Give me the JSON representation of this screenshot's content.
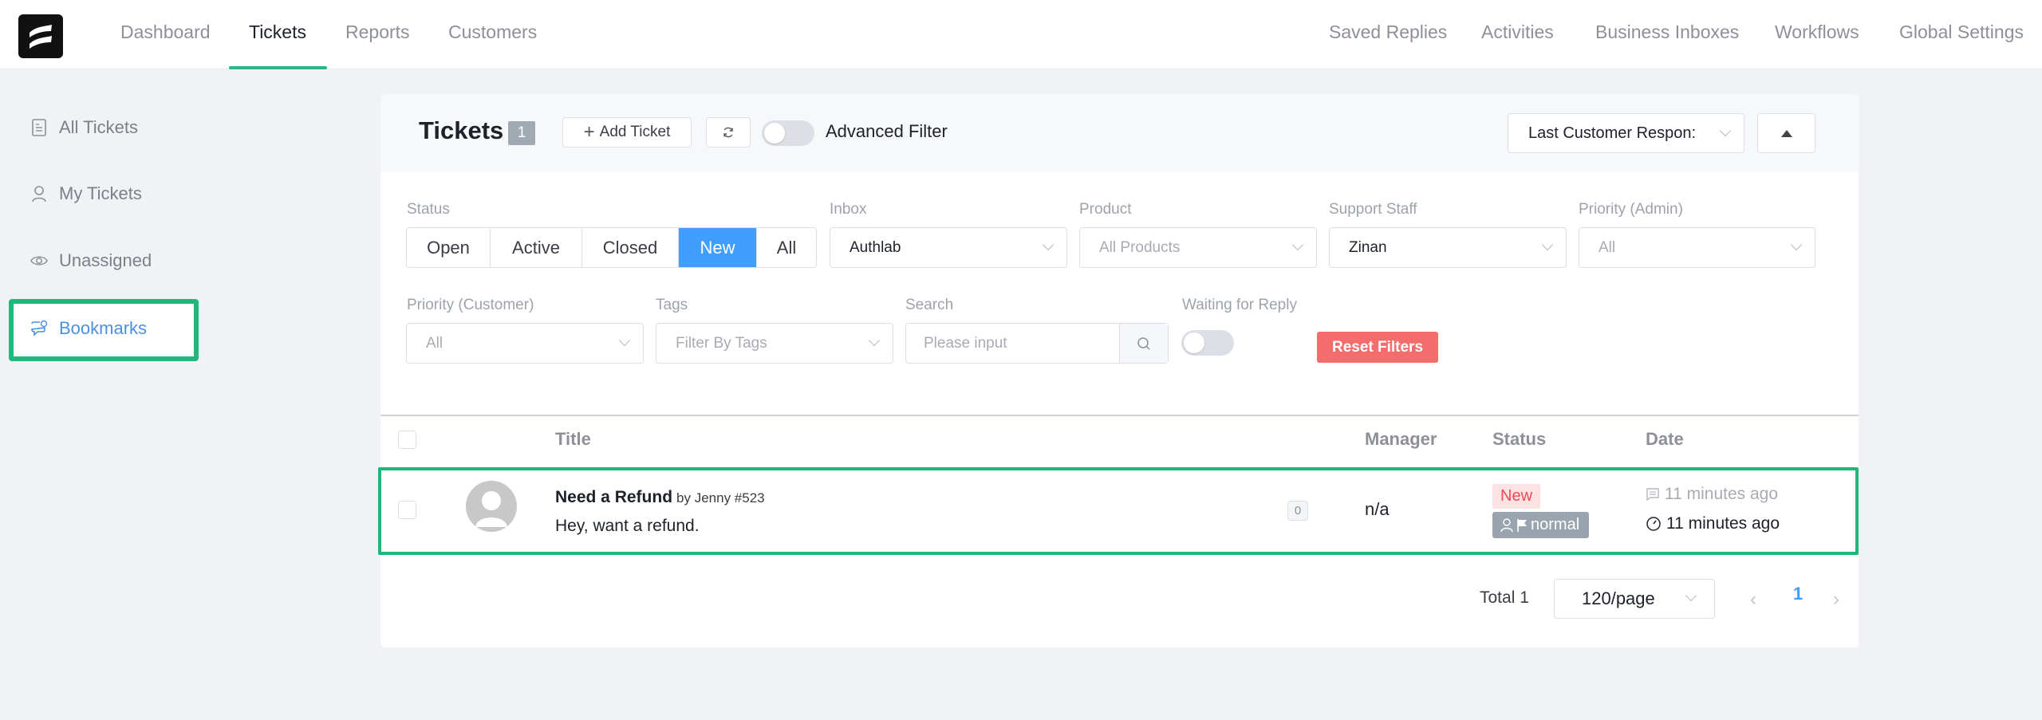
{
  "app": {
    "name": "Fluent Support",
    "accent_color": "#2fb585",
    "highlight_color": "#1fb77a",
    "primary_color": "#409eff"
  },
  "topnav": {
    "left": [
      {
        "label": "Dashboard",
        "active": false
      },
      {
        "label": "Tickets",
        "active": true
      },
      {
        "label": "Reports",
        "active": false
      },
      {
        "label": "Customers",
        "active": false
      }
    ],
    "right": [
      {
        "label": "Saved Replies"
      },
      {
        "label": "Activities"
      },
      {
        "label": "Business Inboxes"
      },
      {
        "label": "Workflows"
      },
      {
        "label": "Global Settings"
      }
    ]
  },
  "sidebar": {
    "items": [
      {
        "label": "All Tickets",
        "icon": "document-icon",
        "active": false
      },
      {
        "label": "My Tickets",
        "icon": "user-icon",
        "active": false
      },
      {
        "label": "Unassigned",
        "icon": "eye-icon",
        "active": false
      },
      {
        "label": "Bookmarks",
        "icon": "chat-bookmark-icon",
        "active": true
      }
    ]
  },
  "header": {
    "title": "Tickets",
    "count": "1",
    "add_ticket_label": "Add Ticket",
    "advanced_filter_label": "Advanced Filter",
    "advanced_filter_on": false,
    "sort_by": "Last Customer Response",
    "sort_by_visible": "Last Customer Respon:",
    "sort_direction": "ascending"
  },
  "filters": {
    "status": {
      "label": "Status",
      "options": [
        "Open",
        "Active",
        "Closed",
        "New",
        "All"
      ],
      "selected": "New"
    },
    "inbox": {
      "label": "Inbox",
      "value": "Authlab"
    },
    "product": {
      "label": "Product",
      "placeholder": "All Products"
    },
    "support_staff": {
      "label": "Support Staff",
      "value": "Zinan"
    },
    "priority_admin": {
      "label": "Priority (Admin)",
      "placeholder": "All"
    },
    "priority_customer": {
      "label": "Priority (Customer)",
      "placeholder": "All"
    },
    "tags": {
      "label": "Tags",
      "placeholder": "Filter By Tags"
    },
    "search": {
      "label": "Search",
      "placeholder": "Please input",
      "value": ""
    },
    "waiting_for_reply": {
      "label": "Waiting for Reply",
      "on": false
    },
    "reset_label": "Reset Filters"
  },
  "table": {
    "columns": [
      "Title",
      "Manager",
      "Status",
      "Date"
    ],
    "rows": [
      {
        "title": "Need a Refund",
        "by": "by Jenny #523",
        "excerpt": "Hey, want a refund.",
        "response_count": "0",
        "manager": "n/a",
        "status": "New",
        "priority": "normal",
        "last_response": "11 minutes ago",
        "created": "11 minutes ago"
      }
    ]
  },
  "pagination": {
    "total_label": "Total 1",
    "page_size": "120/page",
    "current_page": "1"
  }
}
